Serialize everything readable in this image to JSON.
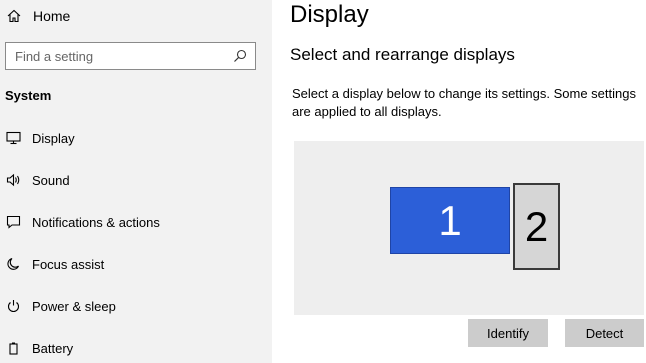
{
  "sidebar": {
    "home_label": "Home",
    "search": {
      "placeholder": "Find a setting"
    },
    "section_title": "System",
    "items": [
      {
        "label": "Display",
        "icon": "monitor-icon"
      },
      {
        "label": "Sound",
        "icon": "speaker-icon"
      },
      {
        "label": "Notifications & actions",
        "icon": "notification-icon"
      },
      {
        "label": "Focus assist",
        "icon": "moon-icon"
      },
      {
        "label": "Power & sleep",
        "icon": "power-icon"
      },
      {
        "label": "Battery",
        "icon": "battery-icon"
      }
    ]
  },
  "main": {
    "title": "Display",
    "subtitle": "Select and rearrange displays",
    "description": "Select a display below to change its settings. Some settings are applied to all displays.",
    "displays": [
      {
        "number": "1",
        "color": "#2c5fd8"
      },
      {
        "number": "2",
        "color": "#d6d6d6"
      }
    ],
    "identify_label": "Identify",
    "detect_label": "Detect"
  }
}
